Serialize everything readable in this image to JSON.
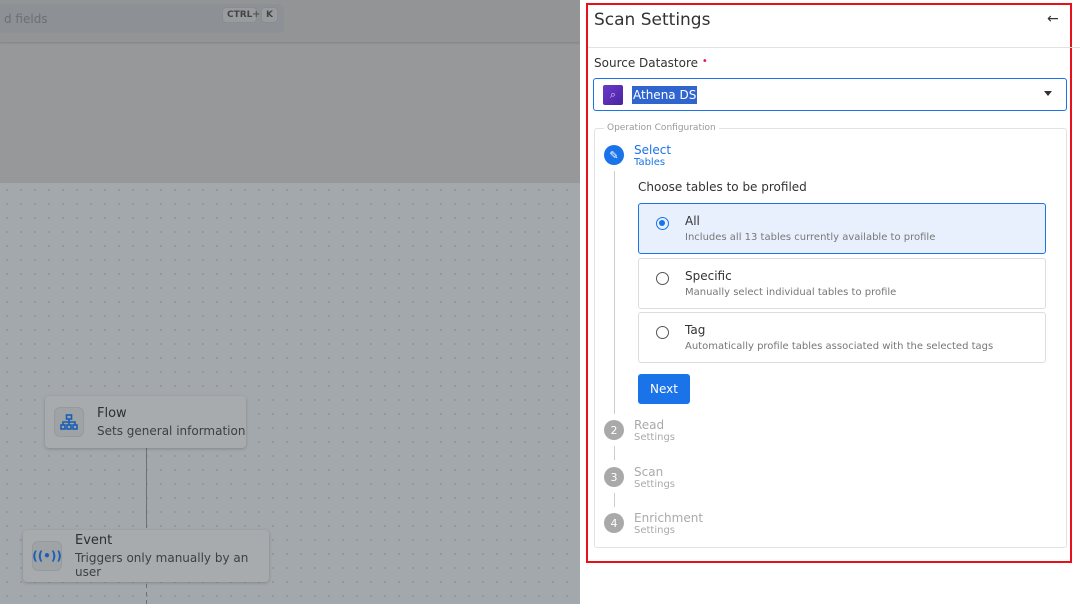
{
  "background": {
    "search": {
      "placeholder_fragment": "d fields",
      "shortcut_keys": [
        "CTRL",
        "K"
      ],
      "plus": "+"
    },
    "nodes": [
      {
        "title": "Flow",
        "subtitle": "Sets general information",
        "icon": "sitemap-icon"
      },
      {
        "title": "Event",
        "subtitle": "Triggers only manually by an user",
        "icon": "broadcast-icon"
      }
    ]
  },
  "panel": {
    "title": "Scan Settings",
    "back_icon": "←",
    "source_label": "Source Datastore",
    "required_mark": "•",
    "datastore": {
      "value": "Athena DS",
      "icon": "athena-icon"
    },
    "operation_legend": "Operation Configuration",
    "steps": [
      {
        "number": "1",
        "title": "Select",
        "subtitle": "Tables",
        "state": "active",
        "icon": "pencil-icon"
      },
      {
        "number": "2",
        "title": "Read",
        "subtitle": "Settings",
        "state": "inactive"
      },
      {
        "number": "3",
        "title": "Scan",
        "subtitle": "Settings",
        "state": "inactive"
      },
      {
        "number": "4",
        "title": "Enrichment",
        "subtitle": "Settings",
        "state": "inactive"
      }
    ],
    "choose_label": "Choose tables to be profiled",
    "options": [
      {
        "title": "All",
        "desc": "Includes all 13 tables currently available to profile",
        "selected": true
      },
      {
        "title": "Specific",
        "desc": "Manually select individual tables to profile",
        "selected": false
      },
      {
        "title": "Tag",
        "desc": "Automatically profile tables associated with the selected tags",
        "selected": false
      }
    ],
    "next_label": "Next",
    "accent": "#1a73e8",
    "highlight_border": "#e8101a"
  }
}
